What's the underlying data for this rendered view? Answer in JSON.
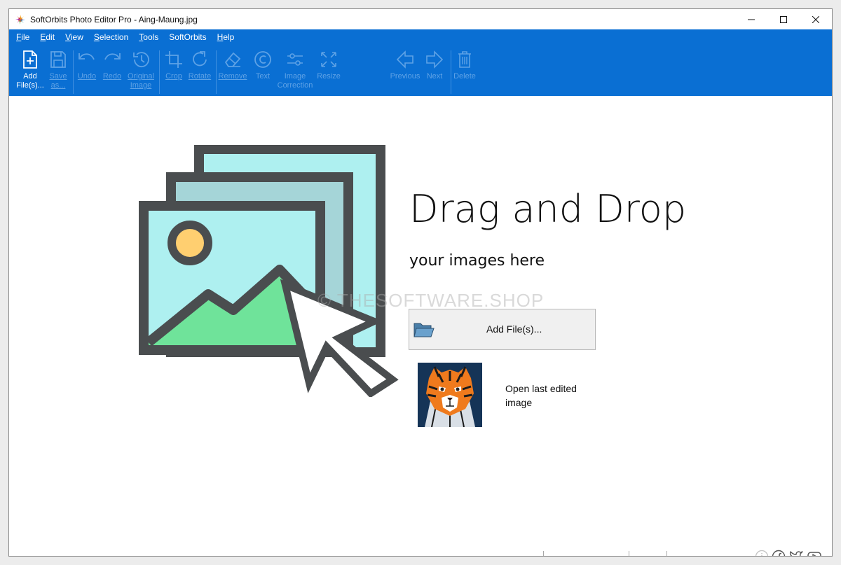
{
  "window": {
    "title": "SoftOrbits Photo Editor Pro - Aing-Maung.jpg"
  },
  "menu": [
    {
      "label": "File",
      "u": "F",
      "rest": "ile"
    },
    {
      "label": "Edit",
      "u": "E",
      "rest": "dit"
    },
    {
      "label": "View",
      "u": "V",
      "rest": "iew"
    },
    {
      "label": "Selection",
      "u": "S",
      "rest": "election"
    },
    {
      "label": "Tools",
      "u": "T",
      "rest": "ools"
    },
    {
      "label": "SoftOrbits",
      "u": "",
      "rest": "SoftOrbits"
    },
    {
      "label": "Help",
      "u": "H",
      "rest": "elp"
    }
  ],
  "toolbar": {
    "add_files": "Add\nFile(s)...",
    "save_as": "Save\nas...",
    "undo": "Undo",
    "redo": "Redo",
    "original_image": "Original\nImage",
    "crop": "Crop",
    "rotate": "Rotate",
    "remove": "Remove",
    "text": "Text",
    "image_correction": "Image\nCorrection",
    "resize": "Resize",
    "previous": "Previous",
    "next": "Next",
    "delete": "Delete"
  },
  "main": {
    "headline": "Drag and Drop",
    "subline": "your images here",
    "add_button_label": "Add File(s)...",
    "open_last": "Open last edited image",
    "watermark": "© THESOFTWARE.SHOP"
  },
  "icons": {
    "app": "softorbits-logo-icon",
    "placeholder": "image-stack-icon",
    "cursor": "arrow-cursor-icon",
    "folder": "folder-icon",
    "social": [
      "info-icon",
      "facebook-icon",
      "twitter-icon",
      "youtube-icon"
    ]
  },
  "colors": {
    "ribbon": "#0a6fd3",
    "disabled_label": "#5ea2e6",
    "frame_fill": "#aef0f0",
    "mountain": "#6fe39a",
    "sun": "#ffcf70",
    "frame_stroke": "#4a4d4f"
  }
}
